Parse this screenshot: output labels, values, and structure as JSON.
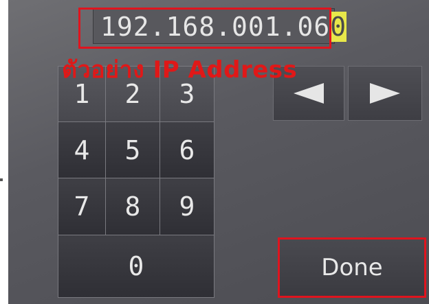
{
  "ip_field": {
    "value_main": "192.168.001.06",
    "value_cursor": "0"
  },
  "caption": "ตัวอย่าง IP Address",
  "keypad": {
    "keys": [
      "1",
      "2",
      "3",
      "4",
      "5",
      "6",
      "7",
      "8",
      "9",
      "0"
    ]
  },
  "arrows": {
    "left_icon": "left-arrow-icon",
    "right_icon": "right-arrow-icon"
  },
  "done_label": "Done",
  "colors": {
    "highlight": "#e0141e",
    "cursor": "#e8e84a",
    "caption": "#e01818"
  }
}
